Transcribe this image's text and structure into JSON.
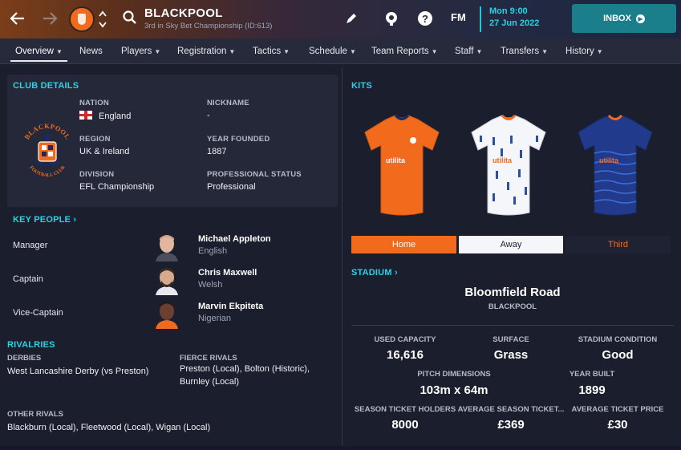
{
  "header": {
    "club_name": "BLACKPOOL",
    "club_subtitle": "3rd in Sky Bet Championship (ID:613)",
    "fm_label": "FM",
    "date_day": "Mon 9:00",
    "date_full": "27 Jun 2022",
    "inbox_label": "INBOX"
  },
  "tabs": [
    {
      "label": "Overview",
      "chevron": "⌄"
    },
    {
      "label": "News",
      "chevron": ""
    },
    {
      "label": "Players",
      "chevron": "⌄"
    },
    {
      "label": "Registration",
      "chevron": "⌄"
    },
    {
      "label": "Tactics",
      "chevron": "⌄"
    },
    {
      "label": "Schedule",
      "chevron": "⌄"
    },
    {
      "label": "Team Reports",
      "chevron": "⌄"
    },
    {
      "label": "Staff",
      "chevron": "⌄"
    },
    {
      "label": "Transfers",
      "chevron": "⌄"
    },
    {
      "label": "History",
      "chevron": "⌄"
    }
  ],
  "club_details": {
    "title": "CLUB DETAILS",
    "nation_label": "NATION",
    "nation_value": "England",
    "nickname_label": "NICKNAME",
    "nickname_value": "-",
    "region_label": "REGION",
    "region_value": "UK & Ireland",
    "year_founded_label": "YEAR FOUNDED",
    "year_founded_value": "1887",
    "division_label": "DIVISION",
    "division_value": "EFL Championship",
    "status_label": "PROFESSIONAL STATUS",
    "status_value": "Professional"
  },
  "key_people": {
    "title": "KEY PEOPLE",
    "people": [
      {
        "role": "Manager",
        "name": "Michael Appleton",
        "nationality": "English"
      },
      {
        "role": "Captain",
        "name": "Chris Maxwell",
        "nationality": "Welsh"
      },
      {
        "role": "Vice-Captain",
        "name": "Marvin Ekpiteta",
        "nationality": "Nigerian"
      }
    ]
  },
  "rivalries": {
    "title": "RIVALRIES",
    "derbies_label": "DERBIES",
    "derbies_value": "West Lancashire Derby (vs Preston)",
    "fierce_label": "FIERCE RIVALS",
    "fierce_line1": "Preston (Local), Bolton (Historic),",
    "fierce_line2": "Burnley (Local)",
    "other_label": "OTHER RIVALS",
    "other_value": "Blackburn (Local), Fleetwood (Local), Wigan (Local)"
  },
  "kits": {
    "title": "KITS",
    "sponsor": "utilita",
    "tabs": [
      {
        "label": "Home",
        "state": "selected"
      },
      {
        "label": "Away",
        "state": "light"
      },
      {
        "label": "Third",
        "state": "dark"
      }
    ],
    "colors": {
      "home": "#f26b1d",
      "away": "#f4f6fa",
      "third": "#223a8c"
    }
  },
  "stadium": {
    "title": "STADIUM",
    "name": "Bloomfield Road",
    "city": "BLACKPOOL",
    "used_capacity_label": "USED CAPACITY",
    "used_capacity_value": "16,616",
    "surface_label": "SURFACE",
    "surface_value": "Grass",
    "condition_label": "STADIUM CONDITION",
    "condition_value": "Good",
    "pitch_label": "PITCH DIMENSIONS",
    "pitch_value": "103m x 64m",
    "year_built_label": "YEAR BUILT",
    "year_built_value": "1899",
    "season_holders_label": "SEASON TICKET HOLDERS",
    "season_holders_value": "8000",
    "avg_season_label": "AVERAGE SEASON TICKET...",
    "avg_season_value": "£369",
    "avg_ticket_label": "AVERAGE TICKET PRICE",
    "avg_ticket_value": "£30"
  },
  "crest": {
    "top_text": "BLACKPOOL",
    "bottom_text": "FOOTBALL CLUB"
  },
  "theme": {
    "accent_cyan": "#2fd0e6",
    "accent_orange": "#f26b1d",
    "inbox_teal": "#1a7f8a",
    "background": "#1b1f2d"
  }
}
